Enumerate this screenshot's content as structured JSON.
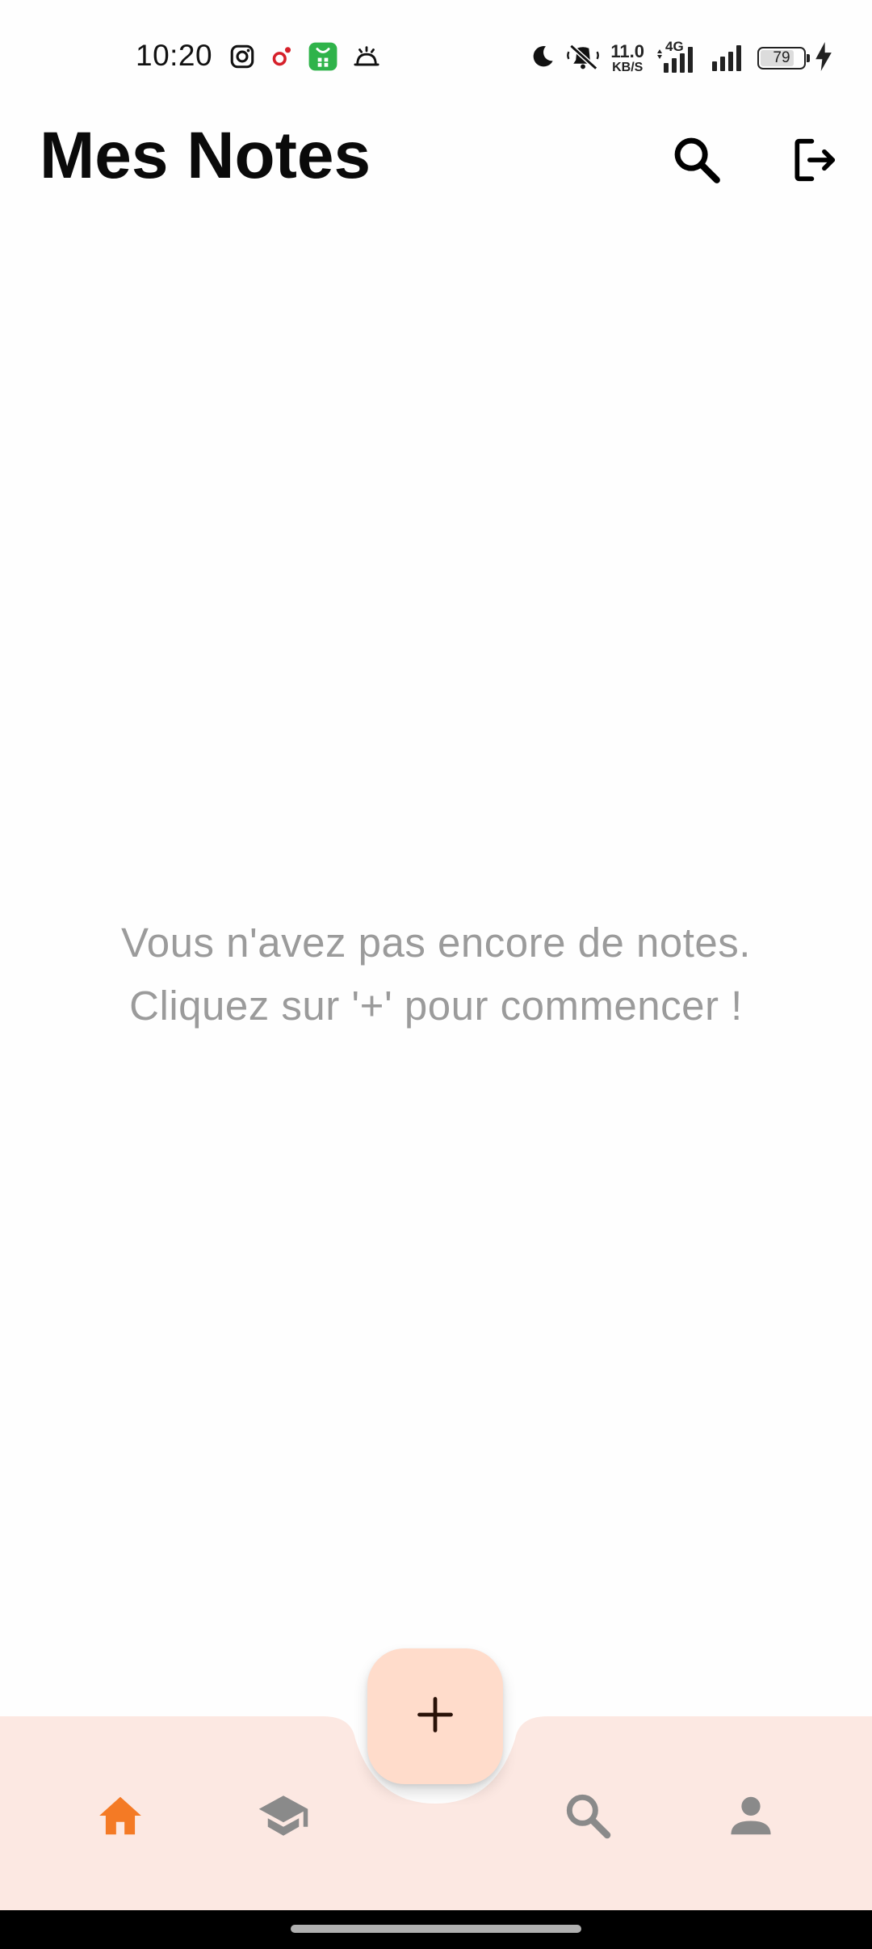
{
  "status_bar": {
    "time": "10:20",
    "left_icons": [
      "instagram-icon",
      "notification-dot-icon",
      "app-store-icon",
      "alarm-icon"
    ],
    "network_speed_value": "11.0",
    "network_speed_unit": "KB/S",
    "network_type": "4G",
    "battery_level": "79"
  },
  "header": {
    "title": "Mes Notes",
    "search_icon": "search-icon",
    "logout_icon": "logout-icon"
  },
  "empty_state": {
    "line1": "Vous n'avez pas encore de notes.",
    "line2": "Cliquez sur '+' pour commencer !"
  },
  "bottom_nav": {
    "background_color": "#fce8e2",
    "active_color": "#f47a25",
    "inactive_color": "#8a8a8a",
    "items": [
      {
        "icon": "home-icon",
        "active": true
      },
      {
        "icon": "graduation-cap-icon",
        "active": false
      },
      {
        "icon": "search-icon",
        "active": false
      },
      {
        "icon": "person-icon",
        "active": false
      }
    ],
    "fab_icon": "plus-icon",
    "fab_color": "#ffdccb"
  }
}
